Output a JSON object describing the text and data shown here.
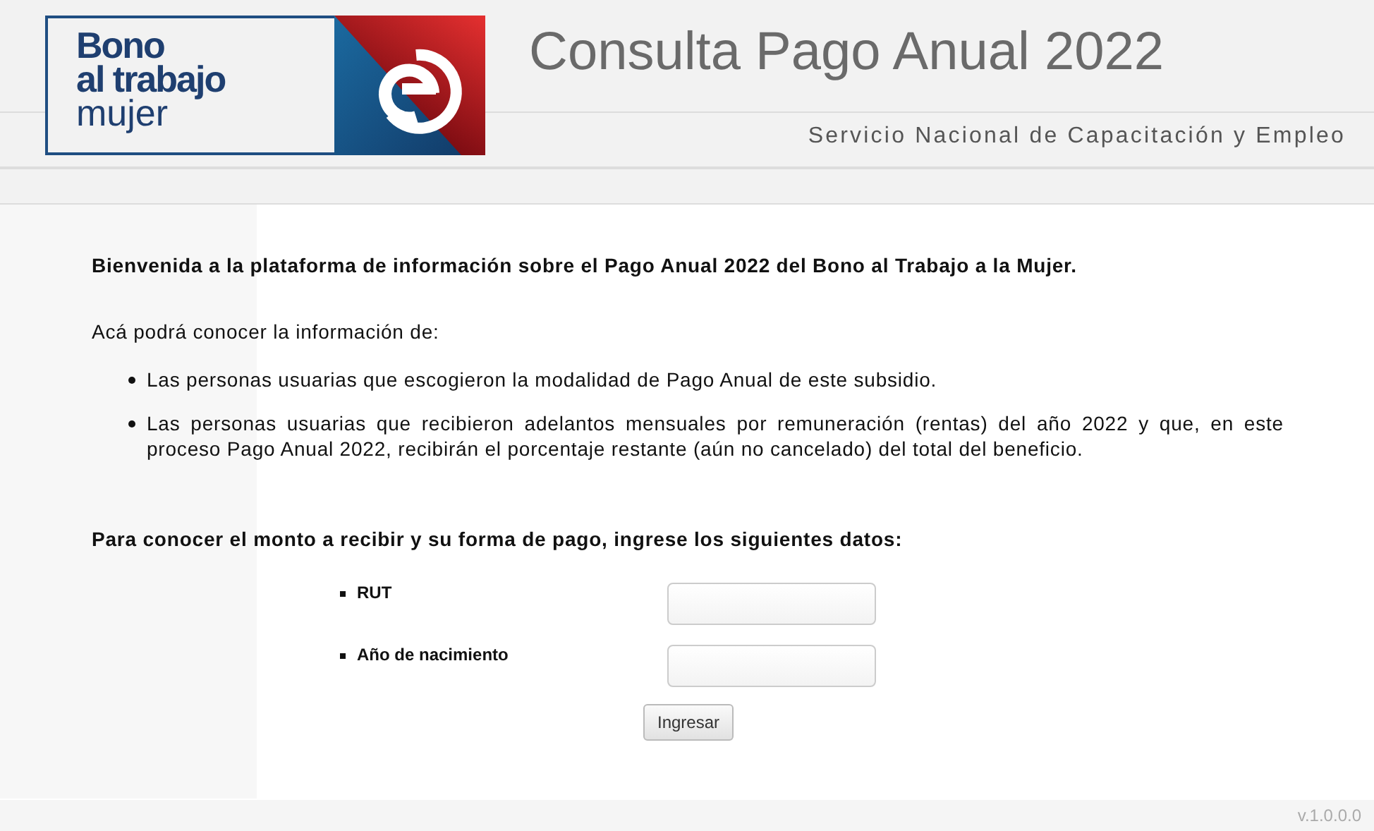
{
  "header": {
    "logo_lines": [
      "Bono",
      "al trabajo",
      "mujer"
    ],
    "title": "Consulta Pago Anual 2022",
    "subtitle": "Servicio Nacional de Capacitación y Empleo"
  },
  "content": {
    "welcome": "Bienvenida a la plataforma de información sobre el Pago Anual 2022 del Bono al Trabajo a la Mujer.",
    "intro": "Acá podrá conocer la información de:",
    "bullets": [
      "Las personas usuarias que escogieron la modalidad de Pago Anual de este subsidio.",
      "Las personas usuarias que recibieron adelantos mensuales por remuneración (rentas) del año 2022 y que, en este proceso Pago Anual 2022, recibirán el porcentaje restante (aún no cancelado) del total del beneficio."
    ],
    "form_prompt": "Para conocer el monto a recibir y su forma de pago, ingrese los siguientes datos:"
  },
  "form": {
    "fields": [
      {
        "label": "RUT"
      },
      {
        "label": "Año de nacimiento"
      }
    ],
    "submit": "Ingresar"
  },
  "footer": {
    "version": "v.1.0.0.0"
  }
}
